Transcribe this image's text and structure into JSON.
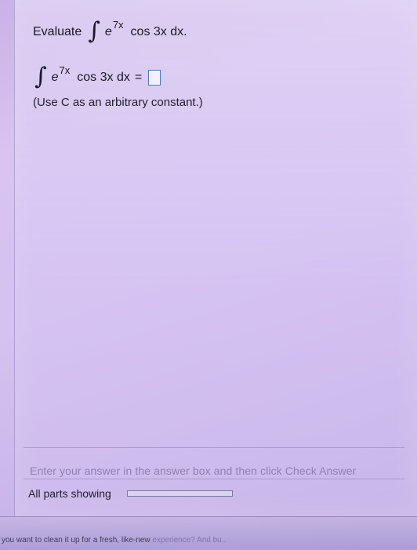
{
  "question": {
    "prefix": "Evaluate",
    "integral_symbol": "∫",
    "exp_base": "e",
    "exp_power": "7x",
    "trig_part": "cos 3x dx."
  },
  "answer": {
    "integral_symbol": "∫",
    "exp_base": "e",
    "exp_power": "7x",
    "trig_part": "cos 3x dx",
    "equals": "="
  },
  "note": {
    "text": "(Use C as an arbitrary constant.)"
  },
  "instruction": {
    "text": "Enter your answer in the answer box and then click Check Answer"
  },
  "parts": {
    "label": "All parts showing",
    "progress_value": 0
  },
  "footer": {
    "text_main": "you want to clean it up for a fresh, like-new ",
    "text_fade": "experience? And bu.."
  },
  "colors": {
    "answer_box_border": "#4e79b8"
  }
}
